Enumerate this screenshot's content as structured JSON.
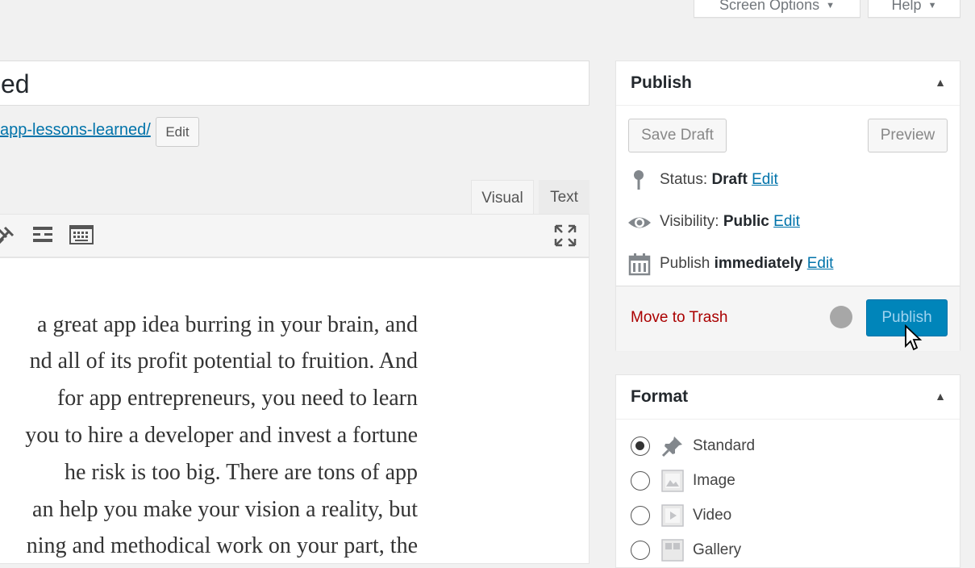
{
  "header": {
    "screen_options_label": "Screen Options",
    "help_label": "Help"
  },
  "post": {
    "title_fragment": "ed",
    "permalink_fragment": "app-lessons-learned/",
    "permalink_edit_label": "Edit"
  },
  "editor": {
    "tabs": {
      "visual": "Visual",
      "text": "Text"
    },
    "content_lines": [
      "a great app idea burring in your brain, and",
      "nd all of its profit potential to fruition. And",
      " for app entrepreneurs, you need to learn",
      "you to hire a developer and invest a fortune",
      "he risk is too big. There are tons of app",
      "an help you make your vision a reality, but",
      "ning and methodical work on your part, the"
    ]
  },
  "publish_box": {
    "title": "Publish",
    "save_draft_label": "Save Draft",
    "preview_label": "Preview",
    "status_label": "Status:",
    "status_value": "Draft",
    "status_edit": "Edit",
    "visibility_label": "Visibility:",
    "visibility_value": "Public",
    "visibility_edit": "Edit",
    "publish_label": "Publish",
    "publish_value": "immediately",
    "publish_edit": "Edit",
    "trash_label": "Move to Trash",
    "publish_button_label": "Publish"
  },
  "format_box": {
    "title": "Format",
    "options": [
      {
        "label": "Standard",
        "icon": "pin-icon",
        "selected": true
      },
      {
        "label": "Image",
        "icon": "image-icon",
        "selected": false
      },
      {
        "label": "Video",
        "icon": "video-icon",
        "selected": false
      },
      {
        "label": "Gallery",
        "icon": "gallery-icon",
        "selected": false
      }
    ]
  },
  "colors": {
    "link": "#0073aa",
    "primary_button": "#0085ba",
    "trash": "#aa0000"
  }
}
